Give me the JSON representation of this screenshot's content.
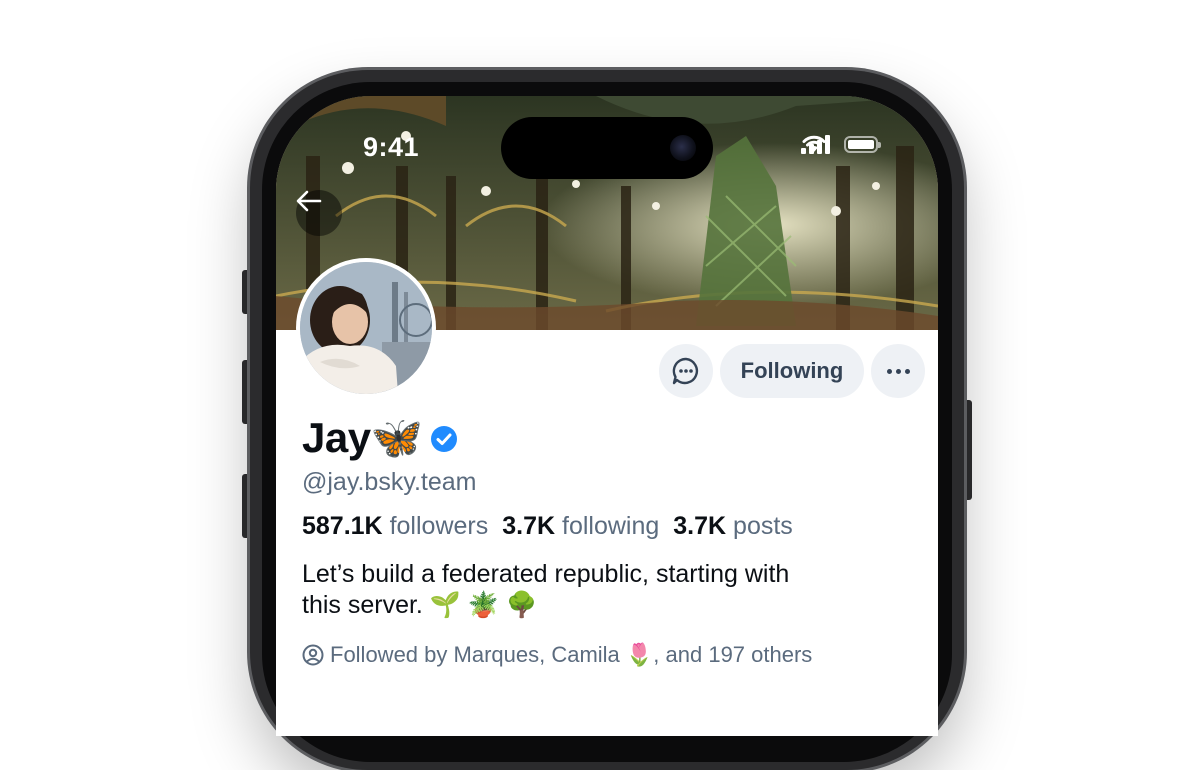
{
  "status_bar": {
    "time": "9:41"
  },
  "profile": {
    "display_name": "Jay🦋",
    "handle": "@jay.bsky.team",
    "stats": {
      "followers_count": "587.1K",
      "followers_label": "followers",
      "following_count": "3.7K",
      "following_label": "following",
      "posts_count": "3.7K",
      "posts_label": "posts"
    },
    "bio_line1": "Let’s build a federated republic, starting with",
    "bio_line2": "this server. 🌱 🪴 🌳",
    "followed_by": "Followed by Marques, Camila 🌷, and 197 others"
  },
  "actions": {
    "follow_label": "Following"
  },
  "colors": {
    "button_bg": "#eef1f5",
    "button_text": "#344356",
    "secondary_text": "#5b6b7e",
    "verified_blue": "#208bfe"
  },
  "icons": [
    "back-arrow-icon",
    "message-icon",
    "more-icon",
    "verified-icon",
    "person-circle-icon",
    "signal-icon",
    "wifi-icon",
    "battery-icon"
  ]
}
